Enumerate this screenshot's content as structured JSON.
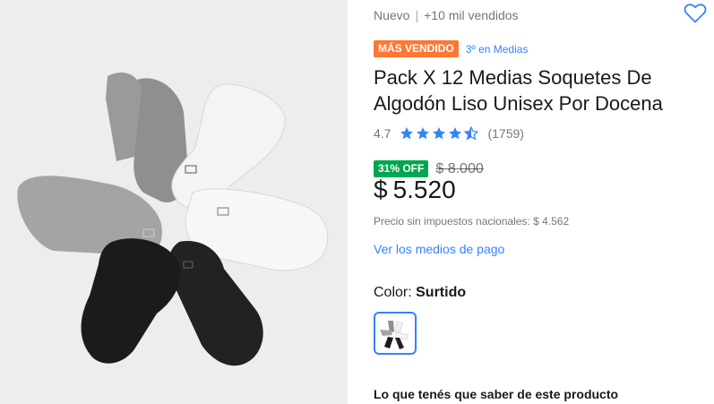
{
  "product": {
    "condition": "Nuevo",
    "sold": "+10 mil vendidos",
    "best_seller_badge": "MÁS VENDIDO",
    "ranking": "3º en Medias",
    "title": "Pack X 12 Medias Soquetes De Algodón Liso Unisex Por Docena",
    "rating": "4.7",
    "rating_value": 4.7,
    "stars": [
      "star-full-icon",
      "star-full-icon",
      "star-full-icon",
      "star-full-icon",
      "star-half-icon"
    ],
    "reviews": "(1759)",
    "discount": "31% OFF",
    "original_price": "$ 8.000",
    "currency": "$",
    "price": "5.520",
    "tax_note": "Precio sin impuestos nacionales: $ 4.562",
    "payment_link": "Ver los medios de pago",
    "color_label": "Color: ",
    "color_value": "Surtido",
    "section_title": "Lo que tenés que saber de este producto"
  },
  "icons": {
    "favorite": "heart-icon",
    "star_full": "star-full-icon",
    "star_half": "star-half-icon"
  },
  "colors": {
    "accent": "#3483fa",
    "best_seller": "#ff7733",
    "discount": "#00a650",
    "gallery_bg": "#ededed"
  }
}
